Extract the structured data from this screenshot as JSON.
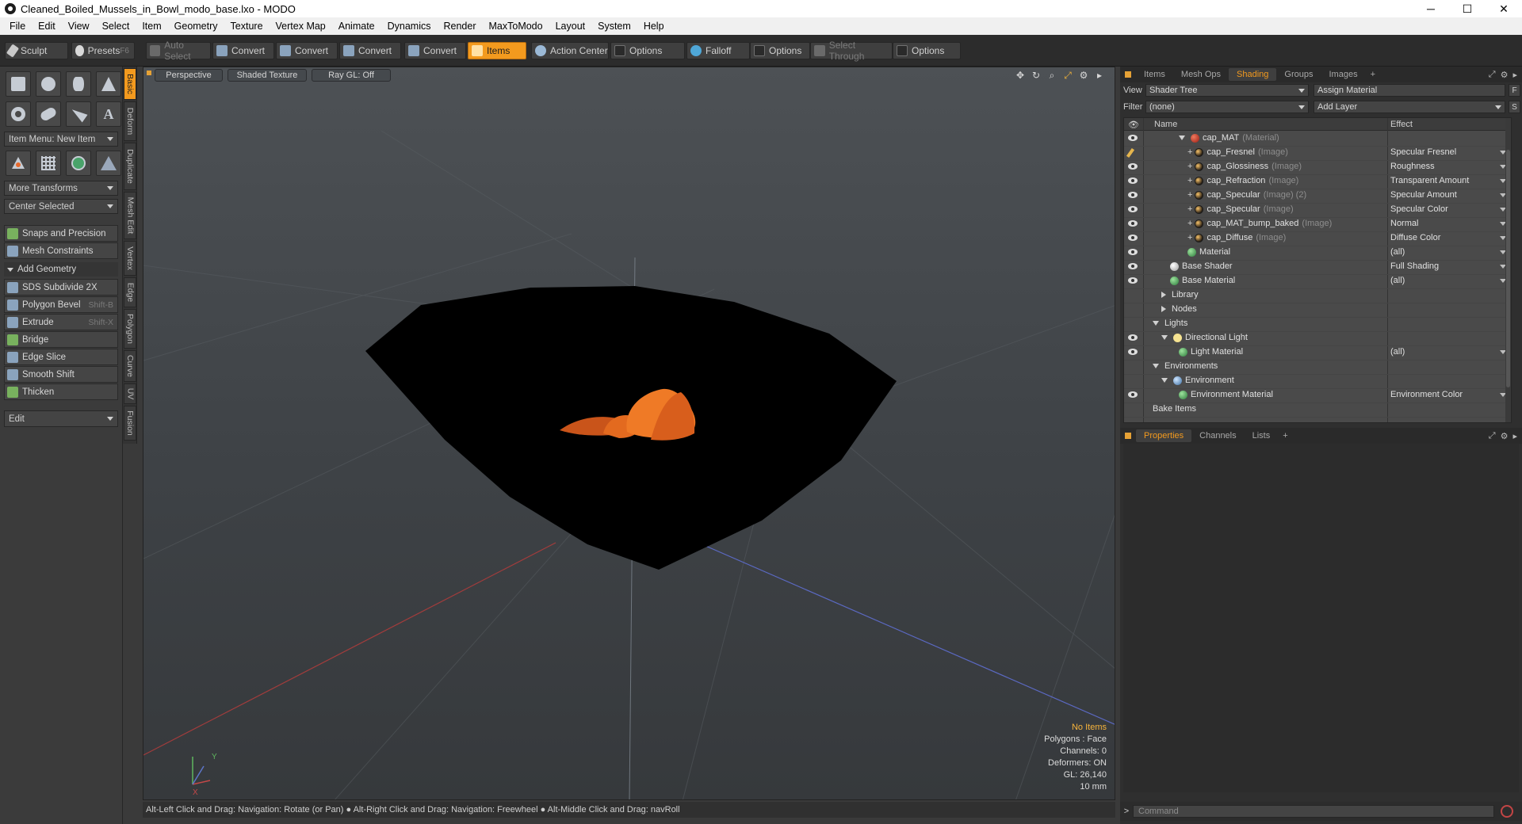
{
  "window": {
    "title": "Cleaned_Boiled_Mussels_in_Bowl_modo_base.lxo - MODO",
    "minimize": "─",
    "maximize": "☐",
    "close": "✕"
  },
  "menu": [
    "File",
    "Edit",
    "View",
    "Select",
    "Item",
    "Geometry",
    "Texture",
    "Vertex Map",
    "Animate",
    "Dynamics",
    "Render",
    "MaxToModo",
    "Layout",
    "System",
    "Help"
  ],
  "toolbar": {
    "sculpt": "Sculpt",
    "presets": "Presets",
    "presets_shortcut": "F6",
    "auto_select": "Auto Select",
    "convert": "Convert",
    "items": "Items",
    "action_center": "Action Center",
    "options": "Options",
    "falloff": "Falloff",
    "select_through": "Select Through"
  },
  "left_panel": {
    "item_menu": "Item Menu: New Item",
    "more_transforms": "More Transforms",
    "center_selected": "Center Selected",
    "snaps": "Snaps and Precision",
    "mesh_constraints": "Mesh Constraints",
    "add_geometry": "Add Geometry",
    "tools": [
      {
        "label": "SDS Subdivide 2X",
        "shortcut": ""
      },
      {
        "label": "Polygon Bevel",
        "shortcut": "Shift-B"
      },
      {
        "label": "Extrude",
        "shortcut": "Shift-X"
      },
      {
        "label": "Bridge",
        "shortcut": ""
      },
      {
        "label": "Edge Slice",
        "shortcut": ""
      },
      {
        "label": "Smooth Shift",
        "shortcut": ""
      },
      {
        "label": "Thicken",
        "shortcut": ""
      }
    ],
    "edit": "Edit"
  },
  "vertical_tabs": [
    "Basic",
    "Deform",
    "Duplicate",
    "Mesh Edit",
    "Vertex",
    "Edge",
    "Polygon",
    "Curve",
    "UV",
    "Fusion"
  ],
  "viewport": {
    "view": "Perspective",
    "shading": "Shaded Texture",
    "raygl": "Ray GL: Off",
    "info": {
      "items": "No Items",
      "polygons": "Polygons : Face",
      "channels": "Channels: 0",
      "deformers": "Deformers: ON",
      "gl": "GL: 26,140",
      "units": "10 mm"
    },
    "axis_y": "Y",
    "axis_x": "X"
  },
  "statusbar": "Alt-Left Click and Drag: Navigation: Rotate (or Pan) ● Alt-Right Click and Drag: Navigation: Freewheel ● Alt-Middle Click and Drag: navRoll",
  "right_panel": {
    "tabs": [
      "Items",
      "Mesh Ops",
      "Shading",
      "Groups",
      "Images"
    ],
    "active_tab": "Shading",
    "view_label": "View",
    "view_value": "Shader Tree",
    "assign_material": "Assign Material",
    "filter_label": "Filter",
    "filter_value": "(none)",
    "add_layer": "Add Layer",
    "f_button": "F",
    "s_button": "S",
    "columns": {
      "name": "Name",
      "effect": "Effect"
    },
    "tree": [
      {
        "name": "cap_MAT",
        "type": "(Material)",
        "effect": "",
        "indent": 3,
        "twirl": "down",
        "icon": "mat-red",
        "eye": true,
        "plus": false
      },
      {
        "name": "cap_Fresnel",
        "type": "(Image)",
        "effect": "Specular Fresnel",
        "indent": 4,
        "twirl": "",
        "icon": "img",
        "eye": false,
        "brush": true,
        "plus": true
      },
      {
        "name": "cap_Glossiness",
        "type": "(Image)",
        "effect": "Roughness",
        "indent": 4,
        "twirl": "",
        "icon": "img",
        "eye": true,
        "plus": true
      },
      {
        "name": "cap_Refraction",
        "type": "(Image)",
        "effect": "Transparent Amount",
        "indent": 4,
        "twirl": "",
        "icon": "img",
        "eye": true,
        "plus": true
      },
      {
        "name": "cap_Specular",
        "type": "(Image) (2)",
        "effect": "Specular Amount",
        "indent": 4,
        "twirl": "",
        "icon": "img",
        "eye": true,
        "plus": true
      },
      {
        "name": "cap_Specular",
        "type": "(Image)",
        "effect": "Specular Color",
        "indent": 4,
        "twirl": "",
        "icon": "img",
        "eye": true,
        "plus": true
      },
      {
        "name": "cap_MAT_bump_baked",
        "type": "(Image)",
        "effect": "Normal",
        "indent": 4,
        "twirl": "",
        "icon": "img",
        "eye": true,
        "plus": true
      },
      {
        "name": "cap_Diffuse",
        "type": "(Image)",
        "effect": "Diffuse Color",
        "indent": 4,
        "twirl": "",
        "icon": "img",
        "eye": true,
        "plus": true
      },
      {
        "name": "Material",
        "type": "",
        "effect": "(all)",
        "indent": 4,
        "twirl": "",
        "icon": "green",
        "eye": true,
        "plus": false
      },
      {
        "name": "Base Shader",
        "type": "",
        "effect": "Full Shading",
        "indent": 2,
        "twirl": "",
        "icon": "white",
        "eye": true,
        "plus": false
      },
      {
        "name": "Base Material",
        "type": "",
        "effect": "(all)",
        "indent": 2,
        "twirl": "",
        "icon": "green",
        "eye": true,
        "plus": false
      },
      {
        "name": "Library",
        "type": "",
        "effect": "",
        "indent": 1,
        "twirl": "right",
        "icon": "",
        "eye": false,
        "plus": false
      },
      {
        "name": "Nodes",
        "type": "",
        "effect": "",
        "indent": 1,
        "twirl": "right",
        "icon": "",
        "eye": false,
        "plus": false
      },
      {
        "name": "Lights",
        "type": "",
        "effect": "",
        "indent": 0,
        "twirl": "down",
        "icon": "",
        "eye": false,
        "plus": false
      },
      {
        "name": "Directional Light",
        "type": "",
        "effect": "",
        "indent": 1,
        "twirl": "down",
        "icon": "light",
        "eye": true,
        "plus": false
      },
      {
        "name": "Light Material",
        "type": "",
        "effect": "(all)",
        "indent": 3,
        "twirl": "",
        "icon": "green",
        "eye": true,
        "plus": false
      },
      {
        "name": "Environments",
        "type": "",
        "effect": "",
        "indent": 0,
        "twirl": "down",
        "icon": "",
        "eye": false,
        "plus": false
      },
      {
        "name": "Environment",
        "type": "",
        "effect": "",
        "indent": 1,
        "twirl": "down",
        "icon": "env",
        "eye": false,
        "plus": false
      },
      {
        "name": "Environment Material",
        "type": "",
        "effect": "Environment Color",
        "indent": 3,
        "twirl": "",
        "icon": "green",
        "eye": true,
        "plus": false
      },
      {
        "name": "Bake Items",
        "type": "",
        "effect": "",
        "indent": 0,
        "twirl": "",
        "icon": "",
        "eye": false,
        "plus": false
      }
    ],
    "lower_tabs": [
      "Properties",
      "Channels",
      "Lists"
    ],
    "lower_active": "Properties",
    "command_prompt": ">",
    "command_placeholder": "Command"
  },
  "colors": {
    "accent": "#f39a1e",
    "mussel": "#e0661b",
    "bowl": "#000000"
  }
}
